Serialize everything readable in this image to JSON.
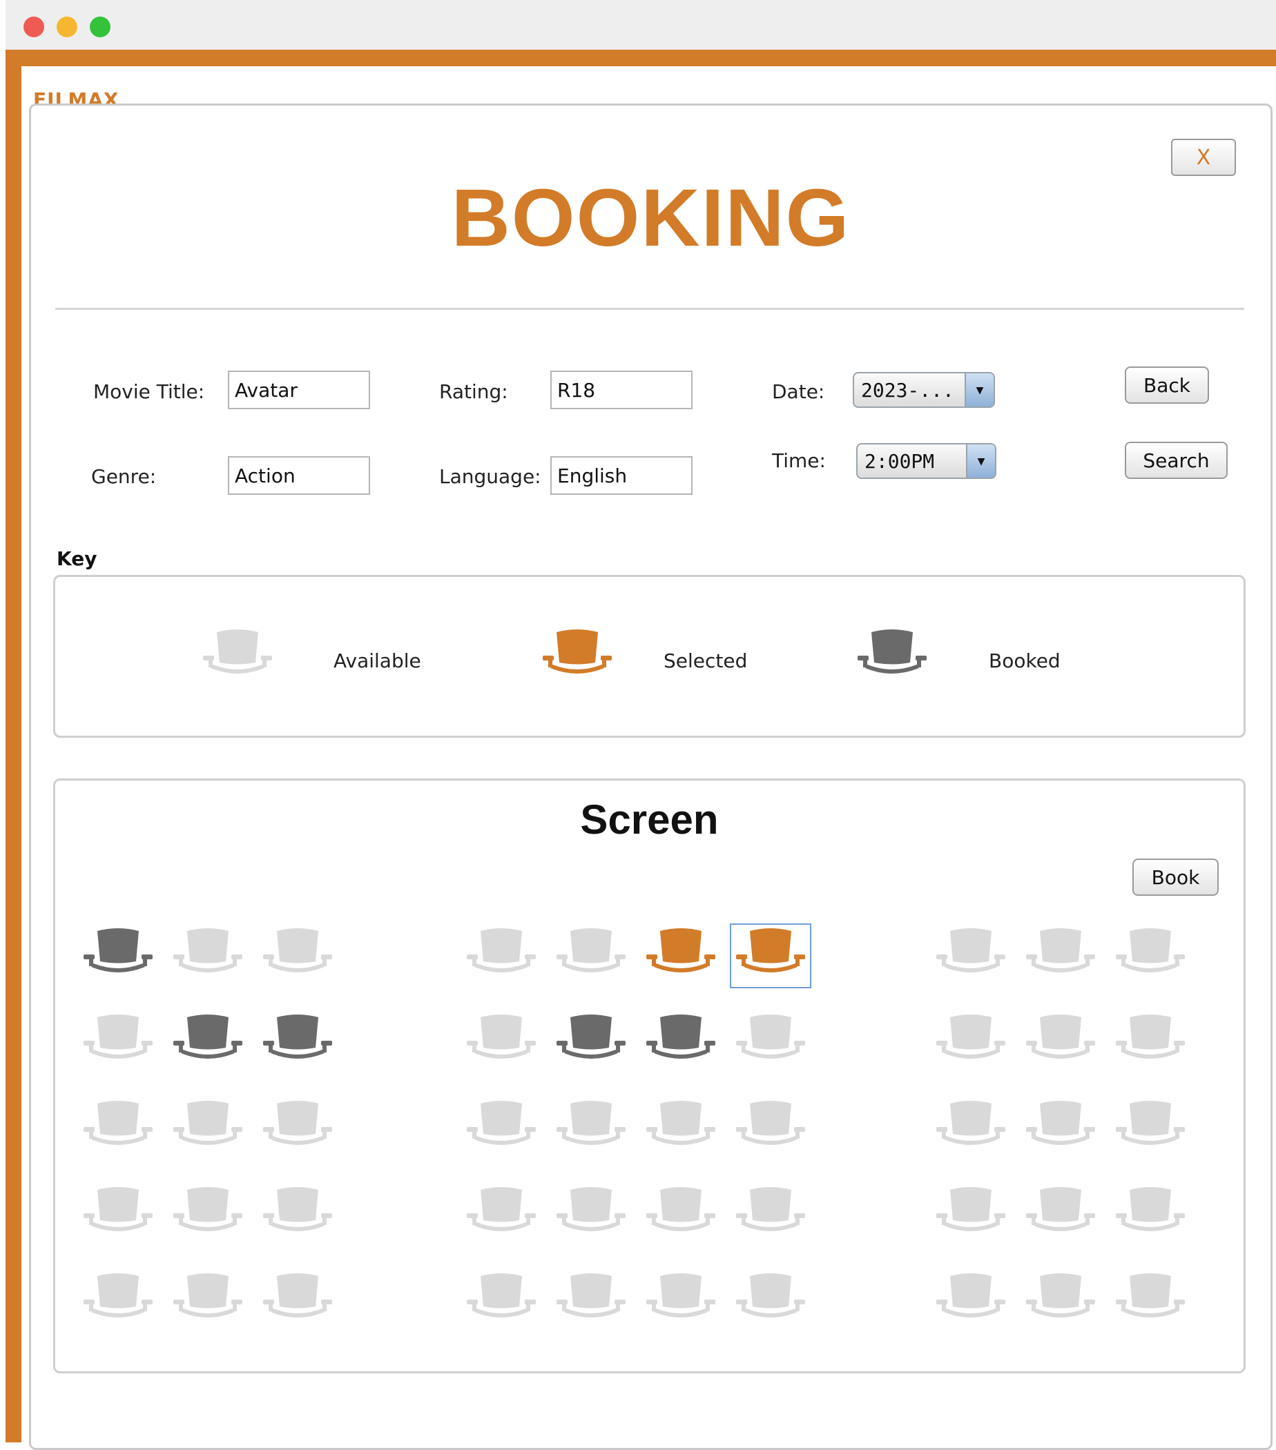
{
  "app": {
    "brand": "FILMAX",
    "close_label": "X",
    "title": "BOOKING"
  },
  "colors": {
    "accent": "#d27b28",
    "seat_available": "#d9d9d9",
    "seat_selected": "#d27b28",
    "seat_booked": "#6a6a6a"
  },
  "form": {
    "movie_title_label": "Movie Title:",
    "movie_title_value": "Avatar",
    "rating_label": "Rating:",
    "rating_value": "R18",
    "date_label": "Date:",
    "date_value": "2023-...",
    "genre_label": "Genre:",
    "genre_value": "Action",
    "language_label": "Language:",
    "language_value": "English",
    "time_label": "Time:",
    "time_value": "2:00PM",
    "back_label": "Back",
    "search_label": "Search"
  },
  "key": {
    "title": "Key",
    "items": [
      {
        "label": "Available",
        "status": "available"
      },
      {
        "label": "Selected",
        "status": "selected"
      },
      {
        "label": "Booked",
        "status": "booked"
      }
    ]
  },
  "seating": {
    "screen_label": "Screen",
    "book_label": "Book",
    "rows": [
      [
        "booked",
        "available",
        "available",
        "available",
        "available",
        "selected",
        "selected",
        "available",
        "available",
        "available"
      ],
      [
        "available",
        "booked",
        "booked",
        "available",
        "booked",
        "booked",
        "available",
        "available",
        "available",
        "available"
      ],
      [
        "available",
        "available",
        "available",
        "available",
        "available",
        "available",
        "available",
        "available",
        "available",
        "available"
      ],
      [
        "available",
        "available",
        "available",
        "available",
        "available",
        "available",
        "available",
        "available",
        "available",
        "available"
      ],
      [
        "available",
        "available",
        "available",
        "available",
        "available",
        "available",
        "available",
        "available",
        "available",
        "available"
      ]
    ]
  }
}
